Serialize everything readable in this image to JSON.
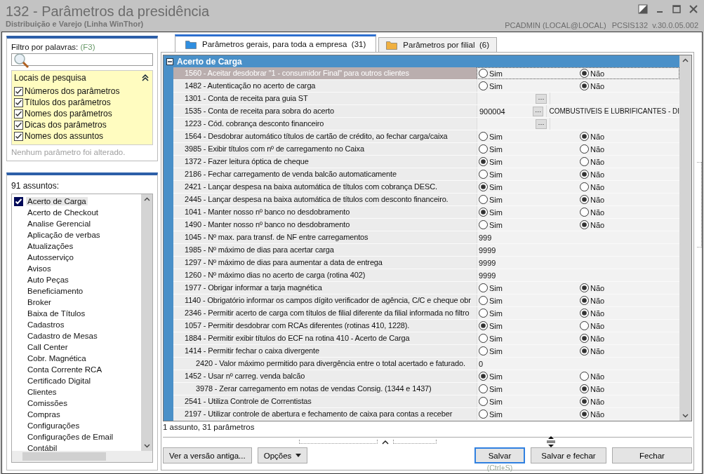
{
  "window": {
    "title": "132 - Parâmetros da presidência",
    "subtitle": "Distribuição e Varejo (Linha WinThor)",
    "user": "PCADMIN (LOCAL@LOCAL)",
    "version": "PCSIS132  v.30.0.05.002"
  },
  "filter": {
    "label": "Filtro por palavras:",
    "shortcut": "(F3)",
    "search_places": {
      "title": "Locais de pesquisa",
      "expanded": true,
      "options": [
        {
          "label": "Números dos parâmetros",
          "checked": true
        },
        {
          "label": "Títulos dos parâmetros",
          "checked": true
        },
        {
          "label": "Nomes dos parâmetros",
          "checked": true
        },
        {
          "label": "Dicas dos parâmetros",
          "checked": true
        },
        {
          "label": "Nomes dos assuntos",
          "checked": true
        }
      ]
    },
    "status": "Nenhum parâmetro foi alterado."
  },
  "subjects": {
    "count_label": "91 assuntos:",
    "items": [
      {
        "label": "Acerto de Carga",
        "checked": true,
        "selected": true
      },
      {
        "label": "Acerto de Checkout",
        "checked": false,
        "selected": false
      },
      {
        "label": "Analise Gerencial",
        "checked": false,
        "selected": false
      },
      {
        "label": "Aplicação de verbas",
        "checked": false,
        "selected": false
      },
      {
        "label": "Atualizações",
        "checked": false,
        "selected": false
      },
      {
        "label": "Autosserviço",
        "checked": false,
        "selected": false
      },
      {
        "label": "Avisos",
        "checked": false,
        "selected": false
      },
      {
        "label": "Auto Peças",
        "checked": false,
        "selected": false
      },
      {
        "label": "Beneficiamento",
        "checked": false,
        "selected": false
      },
      {
        "label": "Broker",
        "checked": false,
        "selected": false
      },
      {
        "label": "Baixa de Títulos",
        "checked": false,
        "selected": false
      },
      {
        "label": "Cadastros",
        "checked": false,
        "selected": false
      },
      {
        "label": "Cadastro de Mesas",
        "checked": false,
        "selected": false
      },
      {
        "label": "Call Center",
        "checked": false,
        "selected": false
      },
      {
        "label": "Cobr. Magnética",
        "checked": false,
        "selected": false
      },
      {
        "label": "Conta Corrente RCA",
        "checked": false,
        "selected": false
      },
      {
        "label": "Certificado Digital",
        "checked": false,
        "selected": false
      },
      {
        "label": "Clientes",
        "checked": false,
        "selected": false
      },
      {
        "label": "Comissões",
        "checked": false,
        "selected": false
      },
      {
        "label": "Compras",
        "checked": false,
        "selected": false
      },
      {
        "label": "Configurações",
        "checked": false,
        "selected": false
      },
      {
        "label": "Configurações de Email",
        "checked": false,
        "selected": false
      },
      {
        "label": "Contábil",
        "checked": false,
        "selected": false
      }
    ]
  },
  "tabs": [
    {
      "label": "Parâmetros gerais, para toda a empresa",
      "count": "(31)",
      "selected": true,
      "color": "#2f8ee0"
    },
    {
      "label": "Parâmetros por filial",
      "count": "(6)",
      "selected": false,
      "color": "#f0b040"
    }
  ],
  "group": {
    "title": "Acerto de Carga",
    "expanded": true,
    "rows": [
      {
        "kind": "radio",
        "name": "1560 - Aceitar desdobrar \"1 - consumidor Final\" para outros clientes",
        "selected": true,
        "options": [
          {
            "label": "Sim",
            "selected": false
          },
          {
            "label": "Não",
            "selected": true
          }
        ]
      },
      {
        "kind": "radio",
        "name": "1482 - Autenticação no acerto de carga",
        "selected": false,
        "options": [
          {
            "label": "Sim",
            "selected": false
          },
          {
            "label": "Não",
            "selected": true
          }
        ]
      },
      {
        "kind": "lookup",
        "name": "1301 - Conta de receita para guia ST",
        "selected": false,
        "button": "···"
      },
      {
        "kind": "lookup",
        "name": "1535 - Conta de receita para sobra do acerto",
        "selected": false,
        "value": "900004",
        "button": "···",
        "description": "COMBUSTIVEIS E LUBRIFICANTES - DI"
      },
      {
        "kind": "lookup",
        "name": "1223 - Cód. cobrança desconto financeiro",
        "selected": false,
        "button": "···"
      },
      {
        "kind": "radio",
        "name": "1564 - Desdobrar automático títulos de cartão de crédito, ao fechar carga/caixa",
        "selected": false,
        "options": [
          {
            "label": "Sim",
            "selected": false
          },
          {
            "label": "Não",
            "selected": true
          }
        ]
      },
      {
        "kind": "radio",
        "name": "3985 - Exibir títulos com nº de carregamento no Caixa",
        "selected": false,
        "options": [
          {
            "label": "Sim",
            "selected": false
          },
          {
            "label": "Não",
            "selected": false
          }
        ]
      },
      {
        "kind": "radio",
        "name": "1372 - Fazer leitura óptica de cheque",
        "selected": false,
        "options": [
          {
            "label": "Sim",
            "selected": true
          },
          {
            "label": "Não",
            "selected": false
          }
        ]
      },
      {
        "kind": "radio",
        "name": "2186 - Fechar carregamento de venda balcão automaticamente",
        "selected": false,
        "options": [
          {
            "label": "Sim",
            "selected": false
          },
          {
            "label": "Não",
            "selected": true
          }
        ]
      },
      {
        "kind": "radio",
        "name": "2421 - Lançar despesa na baixa automática de títulos com cobrança DESC.",
        "selected": false,
        "options": [
          {
            "label": "Sim",
            "selected": true
          },
          {
            "label": "Não",
            "selected": false
          }
        ]
      },
      {
        "kind": "radio",
        "name": "2445 - Lançar despesa na baixa automática de títulos com desconto financeiro.",
        "selected": false,
        "options": [
          {
            "label": "Sim",
            "selected": false
          },
          {
            "label": "Não",
            "selected": true
          }
        ]
      },
      {
        "kind": "radio",
        "name": "1041 - Manter nosso nº banco no desdobramento",
        "selected": false,
        "options": [
          {
            "label": "Sim",
            "selected": true
          },
          {
            "label": "Não",
            "selected": false
          }
        ]
      },
      {
        "kind": "radio",
        "name": "1490 - Manter nosso nº banco no desdobramento",
        "selected": false,
        "options": [
          {
            "label": "Sim",
            "selected": false
          },
          {
            "label": "Não",
            "selected": true
          }
        ]
      },
      {
        "kind": "number",
        "name": "1045 - Nº max. para transf. de NF entre carregamentos",
        "selected": false,
        "value": "999"
      },
      {
        "kind": "number",
        "name": "1985 - Nº máximo de dias para acertar carga",
        "selected": false,
        "value": "9999"
      },
      {
        "kind": "number",
        "name": "1297 - Nº máximo de dias para aumentar a data de entrega",
        "selected": false,
        "value": "9999"
      },
      {
        "kind": "number",
        "name": "1260 - Nº máximo dias no acerto de carga (rotina 402)",
        "selected": false,
        "value": "9999"
      },
      {
        "kind": "radio",
        "name": "1977 - Obrigar informar a tarja magnética",
        "selected": false,
        "options": [
          {
            "label": "Sim",
            "selected": false
          },
          {
            "label": "Não",
            "selected": true
          }
        ]
      },
      {
        "kind": "radio",
        "name": "1140 - Obrigatório informar os campos dígito verificador de agência, C/C e cheque obr",
        "selected": false,
        "options": [
          {
            "label": "Sim",
            "selected": false
          },
          {
            "label": "Não",
            "selected": true
          }
        ]
      },
      {
        "kind": "radio",
        "name": "2346 - Permitir acerto de carga com títulos de filial diferente da filial informada no filtro",
        "selected": false,
        "options": [
          {
            "label": "Sim",
            "selected": false
          },
          {
            "label": "Não",
            "selected": true
          }
        ]
      },
      {
        "kind": "radio",
        "name": "1057 - Permitir desdobrar com RCAs diferentes (rotinas 410, 1228).",
        "selected": false,
        "options": [
          {
            "label": "Sim",
            "selected": true
          },
          {
            "label": "Não",
            "selected": false
          }
        ]
      },
      {
        "kind": "radio",
        "name": "1884 - Permitir exibir títulos do ECF na rotina 410 - Acerto de Carga",
        "selected": false,
        "options": [
          {
            "label": "Sim",
            "selected": false
          },
          {
            "label": "Não",
            "selected": true
          }
        ]
      },
      {
        "kind": "radio",
        "name": "1414 - Permitir fechar o caixa divergente",
        "selected": false,
        "options": [
          {
            "label": "Sim",
            "selected": false
          },
          {
            "label": "Não",
            "selected": true
          }
        ],
        "children": [
          {
            "kind": "number",
            "name": "2420 - Valor máximo permitido para divergência entre o total acertado e faturado.",
            "selected": false,
            "value": "0"
          }
        ]
      },
      {
        "kind": "radio",
        "name": "1452 - Usar nº carreg. venda balcão",
        "selected": false,
        "options": [
          {
            "label": "Sim",
            "selected": true
          },
          {
            "label": "Não",
            "selected": false
          }
        ],
        "children": [
          {
            "kind": "radio",
            "name": "3978 - Zerar carregamento em notas de vendas Consig. (1344 e 1437)",
            "selected": false,
            "options": [
              {
                "label": "Sim",
                "selected": false
              },
              {
                "label": "Não",
                "selected": true
              }
            ]
          }
        ]
      },
      {
        "kind": "radio",
        "name": "2541 - Utiliza Controle de Correntistas",
        "selected": false,
        "options": [
          {
            "label": "Sim",
            "selected": false
          },
          {
            "label": "Não",
            "selected": true
          }
        ]
      },
      {
        "kind": "radio",
        "name": "2197 - Utilizar controle de abertura e fechamento de caixa para contas a receber",
        "selected": false,
        "options": [
          {
            "label": "Sim",
            "selected": false
          },
          {
            "label": "Não",
            "selected": true
          }
        ]
      }
    ]
  },
  "summary": "1 assunto, 31 parâmetros",
  "buttons": [
    {
      "label": "Ver a versão antiga...",
      "kind": "plain",
      "focused": false
    },
    {
      "label": "Opções",
      "kind": "menu",
      "focused": false
    },
    {
      "label": "Salvar",
      "kind": "primary",
      "focused": true,
      "hint": "(Ctrl+S)"
    },
    {
      "label": "Salvar e fechar",
      "kind": "primary",
      "focused": false
    },
    {
      "label": "Fechar",
      "kind": "primary",
      "focused": false
    }
  ]
}
